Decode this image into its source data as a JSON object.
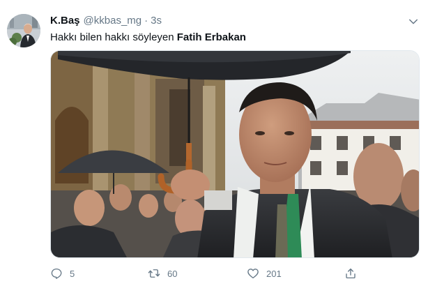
{
  "tweet": {
    "display_name": "K.Baş",
    "handle": "@kkbas_mg",
    "separator": "·",
    "time": "3s",
    "text_prefix": "Hakkı bilen hakkı söyleyen ",
    "text_bold": "Fatih Erbakan",
    "media_icon": "photo-image"
  },
  "actions": {
    "reply_count": "5",
    "retweet_count": "60",
    "like_count": "201",
    "reply_icon": "reply-icon",
    "retweet_icon": "retweet-icon",
    "like_icon": "heart-icon",
    "share_icon": "share-icon"
  },
  "colors": {
    "text": "#0f1419",
    "muted": "#657786",
    "border": "#e1e8ed"
  }
}
